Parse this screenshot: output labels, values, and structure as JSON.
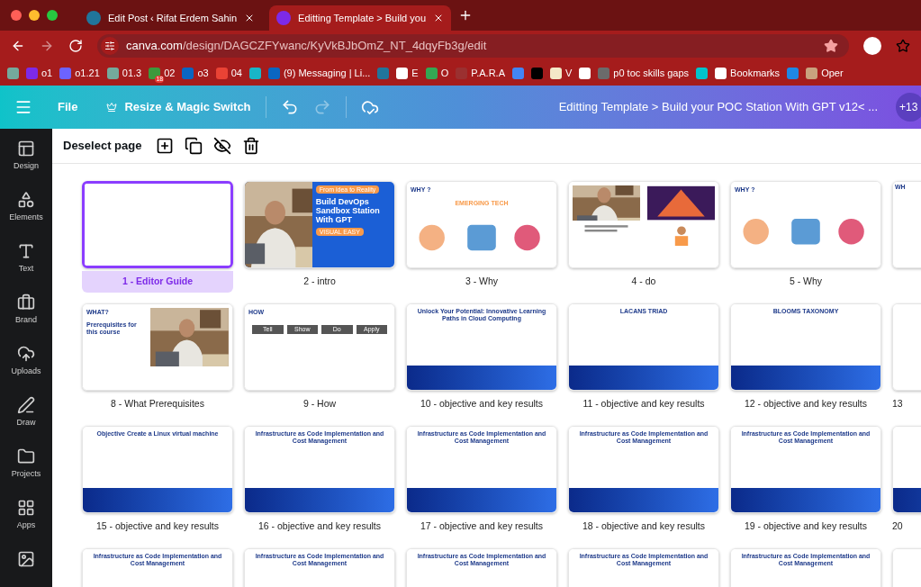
{
  "browser": {
    "tabs": [
      {
        "title": "Edit Post ‹ Rifat Erdem Sahin",
        "selected": false
      },
      {
        "title": "Editting Template > Build you",
        "selected": true
      }
    ],
    "address": {
      "host": "canva.com",
      "path": "/design/DAGCZFYwanc/KyVkBJbOmZ_NT_4dqyFb3g/edit"
    },
    "bookmarks": [
      {
        "color": "#74aa9c"
      },
      {
        "label": "o1",
        "color": "#7d2ae8"
      },
      {
        "label": "o1.21",
        "color": "#6c63ff"
      },
      {
        "label": "01.3",
        "color": "#74aa9c"
      },
      {
        "label": "02",
        "color": "#3c9a3c",
        "badge": "18"
      },
      {
        "label": "o3",
        "color": "#0a66c2"
      },
      {
        "label": "04",
        "color": "#ea4335"
      },
      {
        "color": "#19b5c8"
      },
      {
        "label": "(9) Messaging | Li...",
        "color": "#0a66c2"
      },
      {
        "color": "#21759b"
      },
      {
        "label": "E",
        "color": "#ffffff"
      },
      {
        "label": "O",
        "color": "#34a853"
      },
      {
        "label": "P.A.R.A",
        "color": "#9b3030"
      },
      {
        "color": "#4285f4"
      },
      {
        "color": "#000000"
      },
      {
        "label": "V",
        "color": "#f4e9c8"
      },
      {
        "color": "#ffffff"
      },
      {
        "label": "p0 toc skills gaps",
        "color": "#6b6b6b"
      },
      {
        "color": "#00c4cc"
      },
      {
        "label": "Bookmarks",
        "color": "#ffffff"
      },
      {
        "color": "#1e88e5"
      },
      {
        "label": "Oper",
        "color": "#c9a27e"
      }
    ]
  },
  "header": {
    "menu": "File",
    "resize": "Resize & Magic Switch",
    "title": "Editting Template > Build your  POC Station With GPT v12< ...",
    "collaborators": "+13"
  },
  "sidebar": {
    "items": [
      {
        "label": "Design"
      },
      {
        "label": "Elements"
      },
      {
        "label": "Text"
      },
      {
        "label": "Brand"
      },
      {
        "label": "Uploads"
      },
      {
        "label": "Draw"
      },
      {
        "label": "Projects"
      },
      {
        "label": "Apps"
      }
    ]
  },
  "toolbar": {
    "deselect": "Deselect page"
  },
  "pages": [
    {
      "label": "1 - Editor Guide",
      "selected": true,
      "kind": "blank"
    },
    {
      "label": "2 - intro",
      "selected": false,
      "kind": "hero",
      "heading": "Build DevOps Sandbox Station With GPT",
      "tag": "From idea to Reality",
      "button": "VISUAL EASY"
    },
    {
      "label": "3 - Why",
      "selected": false,
      "kind": "icons",
      "heading": "WHY ?",
      "subheading": "EMERGING TECH"
    },
    {
      "label": "4 - do",
      "selected": false,
      "kind": "split"
    },
    {
      "label": "5 - Why",
      "selected": false,
      "kind": "icons",
      "heading": "WHY ?"
    },
    {
      "selected": false,
      "kind": "plain",
      "heading": "WH"
    },
    {
      "label": "8 - What Prerequisites",
      "selected": false,
      "heading": "WHAT?",
      "subheading": "Prerequisites for this course"
    },
    {
      "label": "9 - How",
      "selected": false,
      "kind": "steps",
      "heading": "HOW",
      "steps": [
        "Tell",
        "Show",
        "Do",
        "Apply"
      ]
    },
    {
      "label": "10 - objective and key results",
      "selected": false,
      "kind": "bluefooter",
      "heading": "Unlock Your Potential: Innovative Learning Paths in Cloud Computing"
    },
    {
      "label": "11 - objective and key results",
      "selected": false,
      "kind": "bluefooter",
      "heading": "LACANS TRIAD"
    },
    {
      "label": "12 - objective and key results",
      "selected": false,
      "kind": "bluefooter",
      "heading": "BLOOMS TAXONOMY"
    },
    {
      "label": "13",
      "selected": false,
      "kind": "blank"
    },
    {
      "label": "15 - objective and key results",
      "selected": false,
      "kind": "bluefooter",
      "heading": "Objective Create a Linux virtual machine"
    },
    {
      "label": "16 - objective and key results",
      "selected": false,
      "kind": "bluefooter",
      "heading": "Infrastructure as Code Implementation and Cost Management"
    },
    {
      "label": "17 - objective and key results",
      "selected": false,
      "kind": "bluefooter",
      "heading": "Infrastructure as Code Implementation and Cost Management"
    },
    {
      "label": "18 - objective and key results",
      "selected": false,
      "kind": "bluefooter",
      "heading": "Infrastructure as Code Implementation and Cost Management"
    },
    {
      "label": "19 - objective and key results",
      "selected": false,
      "kind": "bluefooter",
      "heading": "Infrastructure as Code Implementation and Cost Management"
    },
    {
      "label": "20",
      "selected": false,
      "kind": "bluefooter"
    },
    {
      "selected": false,
      "kind": "bluefooter",
      "heading": "Infrastructure as Code Implementation and Cost Management"
    },
    {
      "selected": false,
      "kind": "bluefooter",
      "heading": "Infrastructure as Code Implementation and Cost Management"
    },
    {
      "selected": false,
      "kind": "bluefooter",
      "heading": "Infrastructure as Code Implementation and Cost Management"
    },
    {
      "selected": false,
      "kind": "bluefooter",
      "heading": "Infrastructure as Code Implementation and Cost Management"
    },
    {
      "selected": false,
      "kind": "bluefooter",
      "heading": "Infrastructure as Code Implementation and Cost Management"
    },
    {
      "selected": false,
      "kind": "blank"
    }
  ]
}
